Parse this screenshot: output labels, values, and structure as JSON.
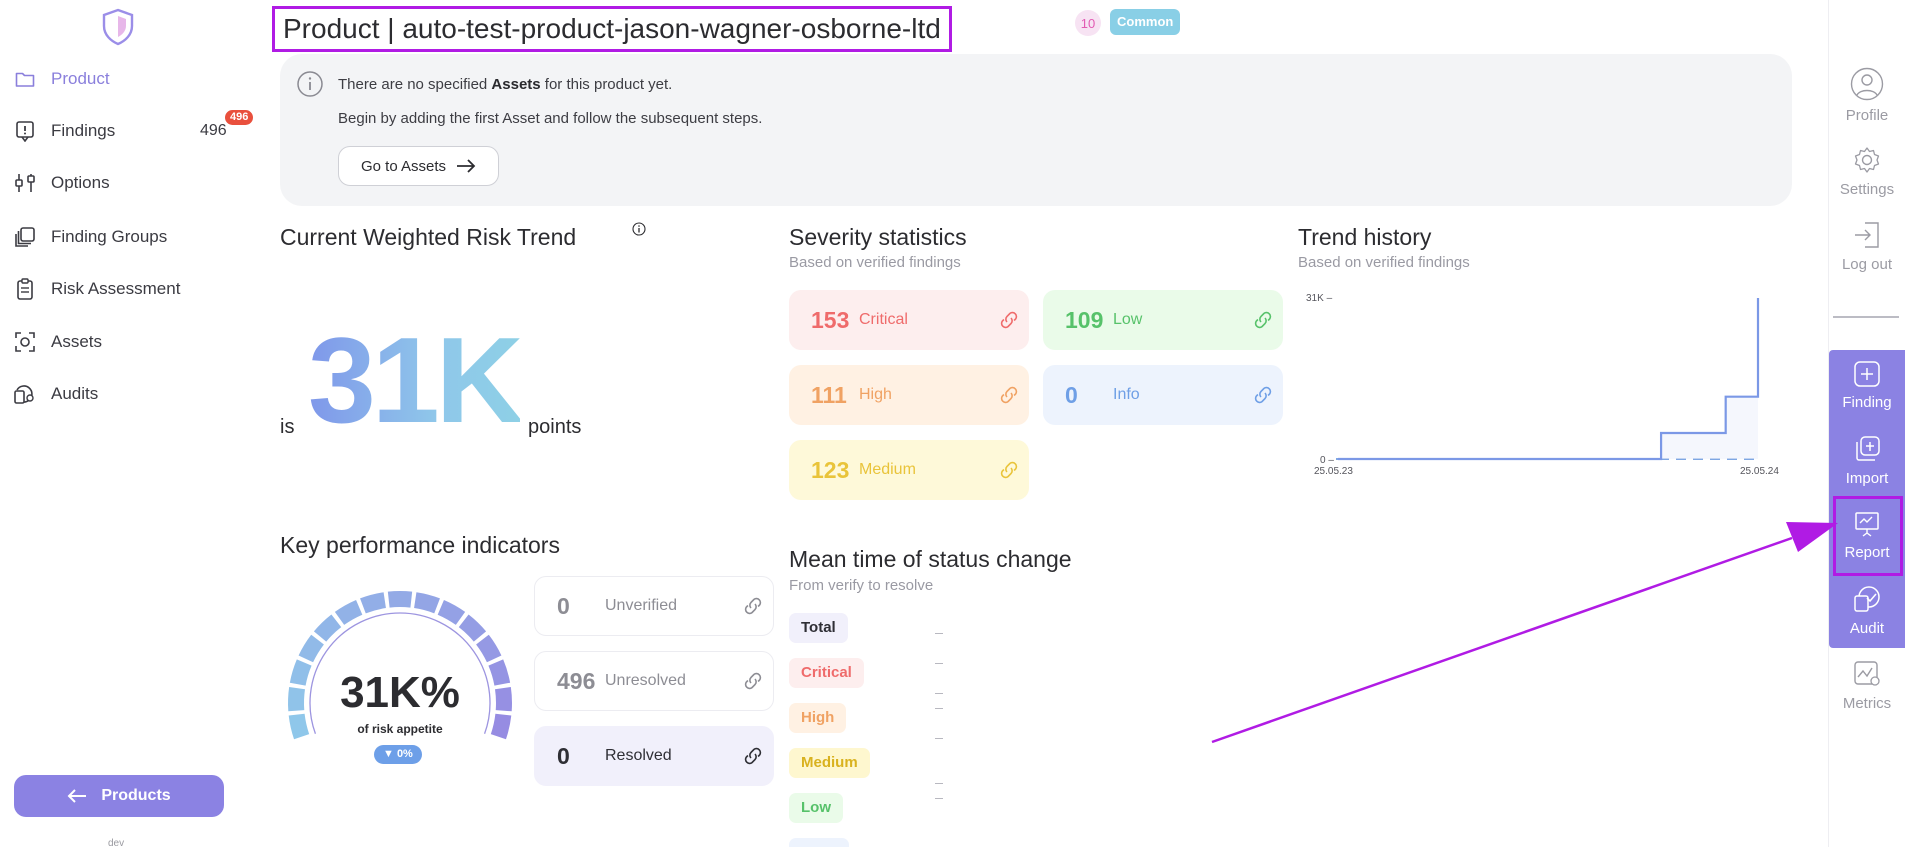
{
  "sidebar": {
    "items": [
      {
        "label": "Product",
        "icon": "folder-icon",
        "active": true
      },
      {
        "label": "Findings",
        "icon": "findings-icon",
        "count": "496",
        "badge": "496"
      },
      {
        "label": "Options",
        "icon": "options-icon"
      },
      {
        "label": "Finding Groups",
        "icon": "finding-groups-icon"
      },
      {
        "label": "Risk Assessment",
        "icon": "clipboard-icon"
      },
      {
        "label": "Assets",
        "icon": "assets-icon"
      },
      {
        "label": "Audits",
        "icon": "audits-icon"
      }
    ],
    "products_button": "Products",
    "env_tag": "dev"
  },
  "header": {
    "title": "Product | auto-test-product-jason-wagner-osborne-ltd",
    "count": "10",
    "tag": "Common"
  },
  "banner": {
    "line1_prefix": "There are no specified ",
    "line1_bold": "Assets",
    "line1_suffix": " for this product yet.",
    "line2": "Begin by adding the first Asset and follow the subsequent steps.",
    "button": "Go to Assets"
  },
  "risk_trend": {
    "title": "Current Weighted Risk Trend",
    "prefix": "is",
    "value": "31K",
    "suffix": "points"
  },
  "severity": {
    "title": "Severity statistics",
    "subtitle": "Based on verified findings",
    "cards": [
      {
        "value": "153",
        "label": "Critical",
        "color": "#ef6b6b",
        "bg": "#fdeeee"
      },
      {
        "value": "109",
        "label": "Low",
        "color": "#57c26a",
        "bg": "#eafbe9"
      },
      {
        "value": "111",
        "label": "High",
        "color": "#f0a263",
        "bg": "#fff1e3"
      },
      {
        "value": "0",
        "label": "Info",
        "color": "#6f9fe6",
        "bg": "#edf3fd"
      },
      {
        "value": "123",
        "label": "Medium",
        "color": "#e9c43a",
        "bg": "#fef9d9"
      }
    ]
  },
  "trend_history": {
    "title": "Trend history",
    "subtitle": "Based on verified findings",
    "y_max_label": "31K –",
    "y_min_label": "0 –",
    "x_start": "25.05.23",
    "x_end": "25.05.24"
  },
  "chart_data": {
    "type": "line",
    "x_labels": [
      "25.05.23",
      "25.05.24"
    ],
    "ylim": [
      0,
      31000
    ],
    "series": [
      {
        "values": [
          0,
          0,
          0,
          0,
          0,
          0,
          0,
          0,
          0,
          0,
          5000,
          5000,
          12000,
          31000
        ]
      }
    ]
  },
  "kpi": {
    "title": "Key performance indicators",
    "gauge_value": "31K%",
    "gauge_label": "of risk appetite",
    "gauge_change": "▼ 0%",
    "gauge_level": 1.0,
    "items": [
      {
        "value": "0",
        "label": "Unverified"
      },
      {
        "value": "496",
        "label": "Unresolved"
      },
      {
        "value": "0",
        "label": "Resolved",
        "active": true
      }
    ]
  },
  "mean_time": {
    "title": "Mean time of status change",
    "subtitle": "From verify to resolve",
    "chips": [
      {
        "label": "Total",
        "color": "#2f2f35",
        "bg": "#f1f0fb"
      },
      {
        "label": "Critical",
        "color": "#ef6b6b",
        "bg": "#fdeeee"
      },
      {
        "label": "High",
        "color": "#f0a263",
        "bg": "#fff1e3"
      },
      {
        "label": "Medium",
        "color": "#d9b21f",
        "bg": "#fef7cf"
      },
      {
        "label": "Low",
        "color": "#57c26a",
        "bg": "#eafbe9"
      }
    ]
  },
  "right_bar": {
    "profile": "Profile",
    "settings": "Settings",
    "logout": "Log out",
    "finding": "Finding",
    "import": "Import",
    "report": "Report",
    "audit": "Audit",
    "metrics": "Metrics"
  },
  "colors": {
    "accent": "#8b82e3",
    "annotation": "#b01be4"
  }
}
